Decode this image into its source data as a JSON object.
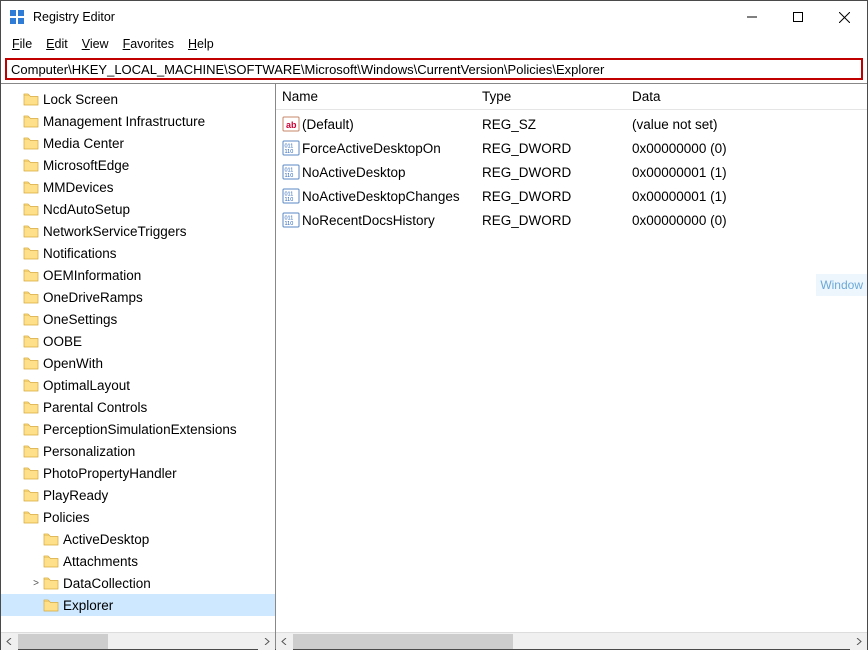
{
  "window": {
    "title": "Registry Editor"
  },
  "menu": {
    "file": "File",
    "edit": "Edit",
    "view": "View",
    "favorites": "Favorites",
    "help": "Help"
  },
  "address": "Computer\\HKEY_LOCAL_MACHINE\\SOFTWARE\\Microsoft\\Windows\\CurrentVersion\\Policies\\Explorer",
  "tree": [
    {
      "label": "Lock Screen",
      "level": 1,
      "expander": ""
    },
    {
      "label": "Management Infrastructure",
      "level": 1,
      "expander": ""
    },
    {
      "label": "Media Center",
      "level": 1,
      "expander": ""
    },
    {
      "label": "MicrosoftEdge",
      "level": 1,
      "expander": ""
    },
    {
      "label": "MMDevices",
      "level": 1,
      "expander": ""
    },
    {
      "label": "NcdAutoSetup",
      "level": 1,
      "expander": ""
    },
    {
      "label": "NetworkServiceTriggers",
      "level": 1,
      "expander": ""
    },
    {
      "label": "Notifications",
      "level": 1,
      "expander": ""
    },
    {
      "label": "OEMInformation",
      "level": 1,
      "expander": ""
    },
    {
      "label": "OneDriveRamps",
      "level": 1,
      "expander": ""
    },
    {
      "label": "OneSettings",
      "level": 1,
      "expander": ""
    },
    {
      "label": "OOBE",
      "level": 1,
      "expander": ""
    },
    {
      "label": "OpenWith",
      "level": 1,
      "expander": ""
    },
    {
      "label": "OptimalLayout",
      "level": 1,
      "expander": ""
    },
    {
      "label": "Parental Controls",
      "level": 1,
      "expander": ""
    },
    {
      "label": "PerceptionSimulationExtensions",
      "level": 1,
      "expander": ""
    },
    {
      "label": "Personalization",
      "level": 1,
      "expander": ""
    },
    {
      "label": "PhotoPropertyHandler",
      "level": 1,
      "expander": ""
    },
    {
      "label": "PlayReady",
      "level": 1,
      "expander": ""
    },
    {
      "label": "Policies",
      "level": 1,
      "expander": ""
    },
    {
      "label": "ActiveDesktop",
      "level": 2,
      "expander": ""
    },
    {
      "label": "Attachments",
      "level": 2,
      "expander": ""
    },
    {
      "label": "DataCollection",
      "level": 2,
      "expander": ">"
    },
    {
      "label": "Explorer",
      "level": 2,
      "expander": "",
      "selected": true
    }
  ],
  "columns": {
    "name": "Name",
    "type": "Type",
    "data": "Data"
  },
  "values": [
    {
      "name": "(Default)",
      "type": "REG_SZ",
      "data": "(value not set)",
      "icon": "sz"
    },
    {
      "name": "ForceActiveDesktopOn",
      "type": "REG_DWORD",
      "data": "0x00000000 (0)",
      "icon": "dw"
    },
    {
      "name": "NoActiveDesktop",
      "type": "REG_DWORD",
      "data": "0x00000001 (1)",
      "icon": "dw"
    },
    {
      "name": "NoActiveDesktopChanges",
      "type": "REG_DWORD",
      "data": "0x00000001 (1)",
      "icon": "dw"
    },
    {
      "name": "NoRecentDocsHistory",
      "type": "REG_DWORD",
      "data": "0x00000000 (0)",
      "icon": "dw"
    }
  ],
  "watermark": "Window"
}
